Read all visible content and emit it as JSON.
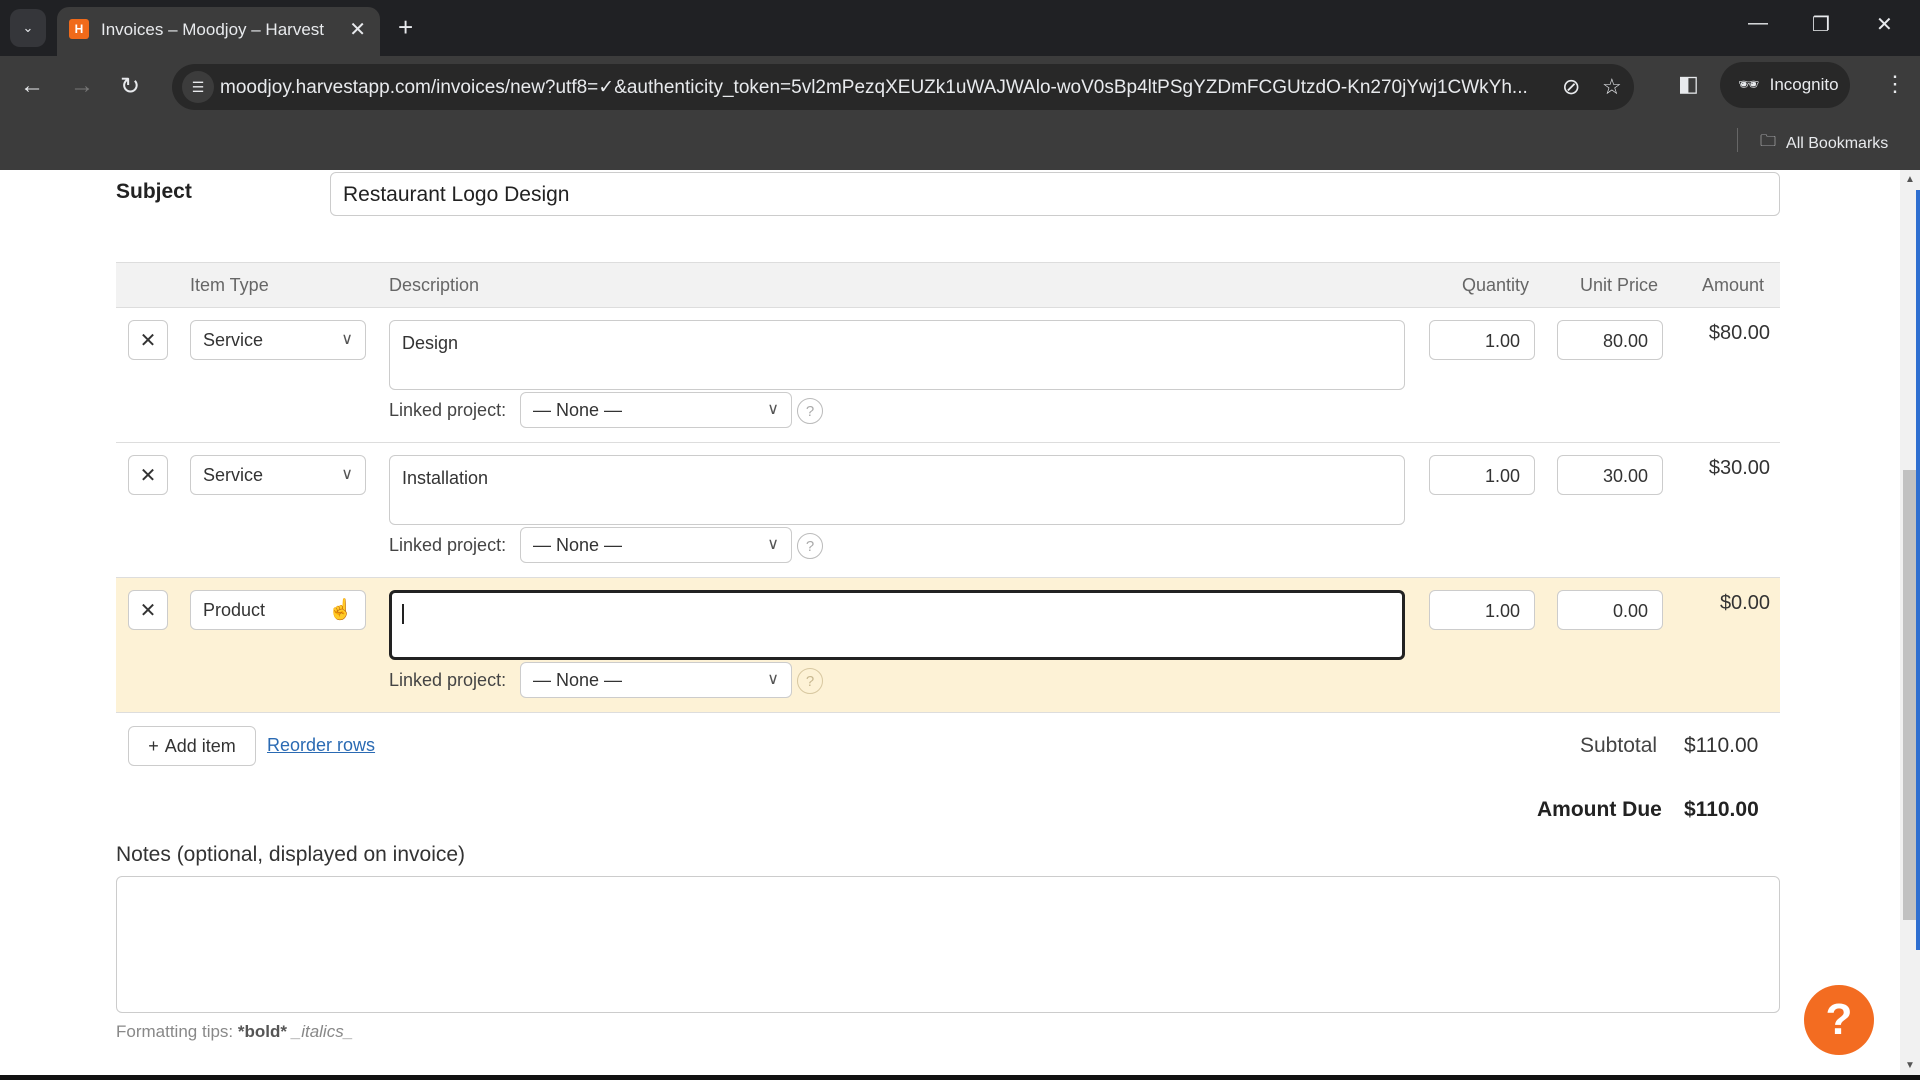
{
  "browser": {
    "tab_title": "Invoices – Moodjoy – Harvest",
    "tab_favicon": "H",
    "url": "moodjoy.harvestapp.com/invoices/new?utf8=✓&authenticity_token=5vl2mPezqXEUZk1uWAJWAlo-woV0sBp4ltPSgYZDmFCGUtzdO-Kn270jYwj1CWkYh...",
    "profile_label": "Incognito",
    "bookmarks_label": "All Bookmarks"
  },
  "form": {
    "subject_label": "Subject",
    "subject_value": "Restaurant Logo Design",
    "columns": {
      "item_type": "Item Type",
      "description": "Description",
      "quantity": "Quantity",
      "unit_price": "Unit Price",
      "amount": "Amount"
    },
    "linked_project_label": "Linked project:",
    "delete_glyph": "✕",
    "help_glyph": "?",
    "rows": [
      {
        "item_type": "Service",
        "description": "Design",
        "linked_project": "— None —",
        "quantity": "1.00",
        "unit_price": "80.00",
        "amount": "$80.00"
      },
      {
        "item_type": "Service",
        "description": "Installation",
        "linked_project": "— None —",
        "quantity": "1.00",
        "unit_price": "30.00",
        "amount": "$30.00"
      },
      {
        "item_type": "Product",
        "description": "",
        "linked_project": "— None —",
        "quantity": "1.00",
        "unit_price": "0.00",
        "amount": "$0.00"
      }
    ],
    "add_item_label": "Add item",
    "reorder_label": "Reorder rows",
    "subtotal_label": "Subtotal",
    "subtotal_value": "$110.00",
    "amount_due_label": "Amount Due",
    "amount_due_value": "$110.00",
    "notes_label": "Notes (optional, displayed on invoice)",
    "notes_value": "",
    "tips_prefix": "Formatting tips:",
    "tips_bold": "*bold*",
    "tips_italic": "_italics_"
  },
  "colors": {
    "highlight_row": "#fdf2d6",
    "help_button": "#f36c21",
    "link": "#2a6ab3"
  }
}
